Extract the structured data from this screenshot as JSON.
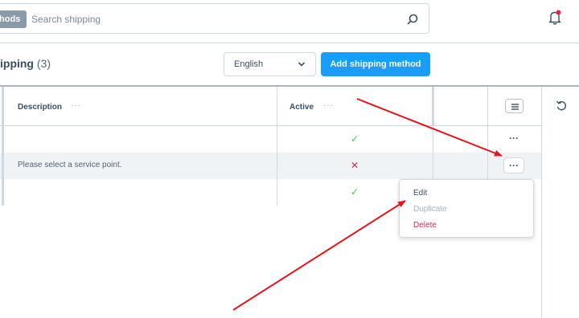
{
  "search": {
    "chip_label": "hods",
    "placeholder": "Search shipping"
  },
  "header": {
    "title": "ipping",
    "count": "(3)",
    "language": "English",
    "add_button": "Add shipping method"
  },
  "grid": {
    "columns": [
      {
        "label": "Description"
      },
      {
        "label": "Active"
      }
    ],
    "rows": [
      {
        "description": "",
        "active": true
      },
      {
        "description": "Please select a service point.",
        "active": false
      },
      {
        "description": "",
        "active": true
      }
    ],
    "row_actions_label": "···"
  },
  "context_menu": {
    "items": [
      "Edit",
      "Duplicate",
      "Delete"
    ]
  },
  "icons": {
    "search": "search-icon",
    "bell": "bell-icon",
    "chevron": "chevron-down-icon",
    "menu": "hamburger-icon",
    "undo": "undo-icon"
  },
  "colors": {
    "accent": "#189eff",
    "active_true": "#37d046",
    "active_false": "#de294c",
    "annotation": "#e8131b"
  },
  "status_glyphs": {
    "true": "✓",
    "false": "✕"
  }
}
